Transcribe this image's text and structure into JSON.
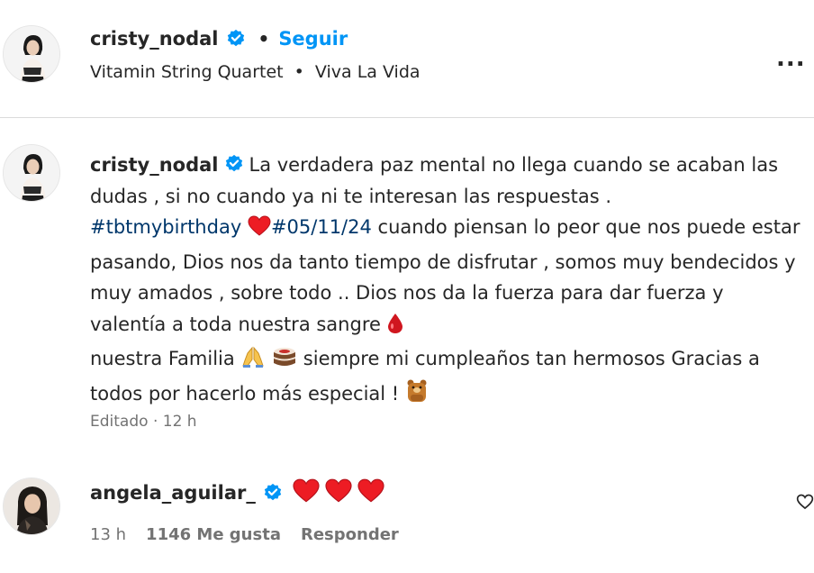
{
  "header": {
    "username": "cristy_nodal",
    "separator": "•",
    "follow_label": "Seguir",
    "audio_artist": "Vitamin String Quartet",
    "audio_sep": "•",
    "audio_track": "Viva La Vida",
    "more_label": "..."
  },
  "caption": {
    "username": "cristy_nodal",
    "text_1": "La verdadera paz mental no llega cuando se acaban las dudas , si no cuando ya ni te interesan las respuestas .",
    "hashtag_1": "#tbtmybirthday",
    "hashtag_2": "#05/11/24",
    "text_2": " cuando piensan lo peor que nos puede estar pasando, Dios nos da tanto tiempo de disfrutar , somos muy bendecidos y muy amados , sobre todo .. Dios nos da la fuerza para dar fuerza y valentía a toda nuestra sangre",
    "text_3": " nuestra Familia",
    "text_4": " siempre mi cumpleaños tan hermosos Gracias a todos por hacerlo más especial !",
    "edited_label": "Editado",
    "meta_sep": "·",
    "time": "12 h",
    "emojis": [
      "red-heart-icon",
      "drop-of-blood-icon",
      "praying-hands-icon",
      "cake-icon",
      "bear-icon"
    ]
  },
  "comment": {
    "username": "angela_aguilar_",
    "hearts": [
      "red-heart-icon",
      "red-heart-icon",
      "red-heart-icon"
    ],
    "time": "13 h",
    "likes": "1146 Me gusta",
    "reply_label": "Responder"
  },
  "colors": {
    "link_blue": "#0095f6",
    "hashtag": "#00376b",
    "verified": "#0095f6",
    "heart": "#ed1c24",
    "muted": "#737373",
    "divider": "#dbdbdb"
  }
}
